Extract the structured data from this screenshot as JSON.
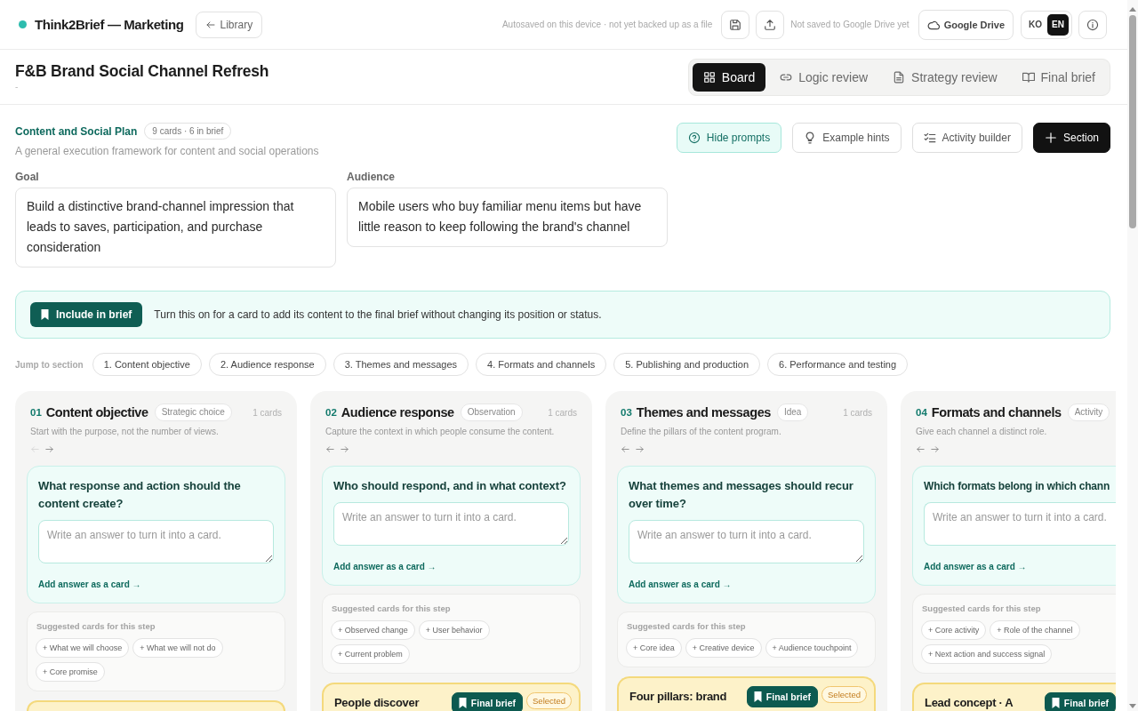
{
  "app": {
    "name": "Think2Brief — Marketing",
    "back_link": "Library",
    "autosave_status": "Autosaved on this device · not yet backed up as a file",
    "drive_status": "Not saved to Google Drive yet",
    "drive_button": "Google Drive",
    "languages": [
      {
        "label": "KO",
        "selected": false
      },
      {
        "label": "EN",
        "selected": true
      }
    ]
  },
  "project": {
    "title": "F&B Brand Social Channel Refresh",
    "subtitle": "-"
  },
  "views": [
    {
      "label": "Board",
      "selected": true
    },
    {
      "label": "Logic review",
      "selected": false
    },
    {
      "label": "Strategy review",
      "selected": false
    },
    {
      "label": "Final brief",
      "selected": false
    }
  ],
  "plan": {
    "name": "Content and Social Plan",
    "count": "9 cards · 6 in brief",
    "description": "A general execution framework for content and social operations",
    "actions": [
      {
        "label": "Hide prompts",
        "kind": "toggle",
        "on": true
      },
      {
        "label": "Example hints",
        "kind": "toggle",
        "on": false
      },
      {
        "label": "Activity builder",
        "kind": "action"
      },
      {
        "label": "Section",
        "kind": "primary"
      }
    ],
    "fields": [
      {
        "label": "Goal",
        "value": "Build a distinctive brand-channel impression that leads to saves, participation, and purchase consideration"
      },
      {
        "label": "Audience",
        "value": "Mobile users who buy familiar menu items but have little reason to keep following the brand's channel"
      }
    ]
  },
  "brief_tip": {
    "button": "Include in brief",
    "text": "Turn this on for a card to add its content to the final brief without changing its position or status."
  },
  "jump": {
    "label": "Jump to section",
    "sections": [
      "1. Content objective",
      "2. Audience response",
      "3. Themes and messages",
      "4. Formats and channels",
      "5. Publishing and production",
      "6. Performance and testing"
    ]
  },
  "columns": [
    {
      "number": "01",
      "title": "Content objective",
      "type": "Strategic choice",
      "count": "1 cards",
      "description": "Start with the purpose, not the number of views.",
      "left_disabled": true,
      "prompt": {
        "question": "What response and action should the content create?",
        "placeholder": "Write an answer to turn it into a card.",
        "action": "Add answer as a card →"
      },
      "suggestions": {
        "label": "Suggested cards for this step",
        "items": [
          "+ What we will choose",
          "+ What we will not do",
          "+ Core promise"
        ]
      },
      "cards": [
        {
          "kind": "peek"
        }
      ]
    },
    {
      "number": "02",
      "title": "Audience response",
      "type": "Observation",
      "count": "1 cards",
      "description": "Capture the context in which people consume the content.",
      "left_disabled": false,
      "prompt": {
        "question": "Who should respond, and in what context?",
        "placeholder": "Write an answer to turn it into a card.",
        "action": "Add answer as a card →"
      },
      "suggestions": {
        "label": "Suggested cards for this step",
        "items": [
          "+ Observed change",
          "+ User behavior",
          "+ Current problem"
        ]
      },
      "cards": [
        {
          "kind": "full",
          "title": "People discover",
          "brief_label": "Final brief",
          "in_brief": true,
          "status": "Selected",
          "selected": true
        }
      ]
    },
    {
      "number": "03",
      "title": "Themes and messages",
      "type": "Idea",
      "count": "1 cards",
      "description": "Define the pillars of the content program.",
      "left_disabled": false,
      "prompt": {
        "question": "What themes and messages should recur over time?",
        "placeholder": "Write an answer to turn it into a card.",
        "action": "Add answer as a card →"
      },
      "suggestions": {
        "label": "Suggested cards for this step",
        "items": [
          "+ Core idea",
          "+ Creative device",
          "+ Audience touchpoint"
        ]
      },
      "cards": [
        {
          "kind": "full",
          "title": "Four pillars: brand",
          "brief_label": "Final brief",
          "in_brief": true,
          "status": "Selected",
          "selected": true
        }
      ]
    },
    {
      "number": "04",
      "title": "Formats and channels",
      "type": "Activity",
      "description": "Give each channel a distinct role.",
      "left_disabled": false,
      "prompt": {
        "question": "Which formats belong in which chann",
        "placeholder": "Write an answer to turn it into a card.",
        "action": "Add answer as a card →"
      },
      "suggestions": {
        "label": "Suggested cards for this step",
        "items": [
          "+ Core activity",
          "+ Role of the channel",
          "+ Next action and success signal"
        ]
      },
      "cards": [
        {
          "kind": "full",
          "title": "Lead concept · A",
          "brief_label": "Final brief",
          "in_brief": true
        }
      ]
    }
  ]
}
